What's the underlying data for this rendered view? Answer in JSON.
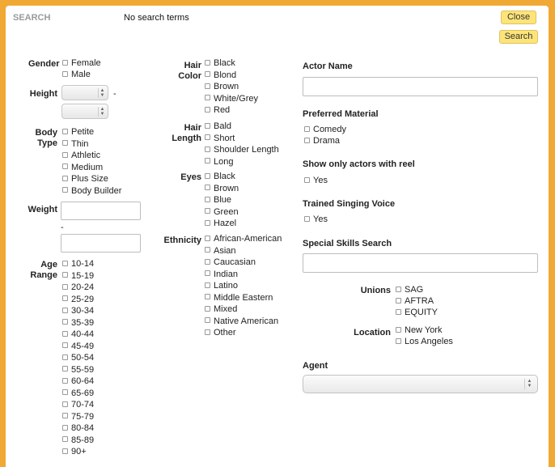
{
  "header": {
    "title": "SEARCH",
    "status": "No search terms",
    "close_label": "Close",
    "search_label": "Search"
  },
  "left": {
    "gender": {
      "label": "Gender",
      "options": [
        "Female",
        "Male"
      ]
    },
    "height": {
      "label": "Height",
      "separator": "-"
    },
    "body_type": {
      "label_1": "Body",
      "label_2": "Type",
      "options": [
        "Petite",
        "Thin",
        "Athletic",
        "Medium",
        "Plus Size",
        "Body Builder"
      ]
    },
    "weight": {
      "label": "Weight",
      "separator": "-"
    },
    "age_range": {
      "label_1": "Age",
      "label_2": "Range",
      "options": [
        "10-14",
        "15-19",
        "20-24",
        "25-29",
        "30-34",
        "35-39",
        "40-44",
        "45-49",
        "50-54",
        "55-59",
        "60-64",
        "65-69",
        "70-74",
        "75-79",
        "80-84",
        "85-89",
        "90+"
      ]
    }
  },
  "middle": {
    "hair_color": {
      "label_1": "Hair",
      "label_2": "Color",
      "options": [
        "Black",
        "Blond",
        "Brown",
        "White/Grey",
        "Red"
      ]
    },
    "hair_length": {
      "label_1": "Hair",
      "label_2": "Length",
      "options": [
        "Bald",
        "Short",
        "Shoulder Length",
        "Long"
      ]
    },
    "eyes": {
      "label": "Eyes",
      "options": [
        "Black",
        "Brown",
        "Blue",
        "Green",
        "Hazel"
      ]
    },
    "ethnicity": {
      "label": "Ethnicity",
      "options": [
        "African-American",
        "Asian",
        "Caucasian",
        "Indian",
        "Latino",
        "Middle Eastern",
        "Mixed",
        "Native American",
        "Other"
      ]
    }
  },
  "right": {
    "actor_name": {
      "label": "Actor Name",
      "value": ""
    },
    "preferred_material": {
      "label": "Preferred Material",
      "options": [
        "Comedy",
        "Drama"
      ]
    },
    "reel": {
      "label": "Show only actors with reel",
      "options": [
        "Yes"
      ]
    },
    "singing": {
      "label": "Trained Singing Voice",
      "options": [
        "Yes"
      ]
    },
    "skills": {
      "label": "Special Skills Search",
      "value": ""
    },
    "unions": {
      "label": "Unions",
      "options": [
        "SAG",
        "AFTRA",
        "EQUITY"
      ]
    },
    "location": {
      "label": "Location",
      "options": [
        "New York",
        "Los Angeles"
      ]
    },
    "agent": {
      "label": "Agent",
      "selected": ""
    }
  },
  "colors": {
    "background": "#f0a935",
    "button": "#fde47a"
  }
}
